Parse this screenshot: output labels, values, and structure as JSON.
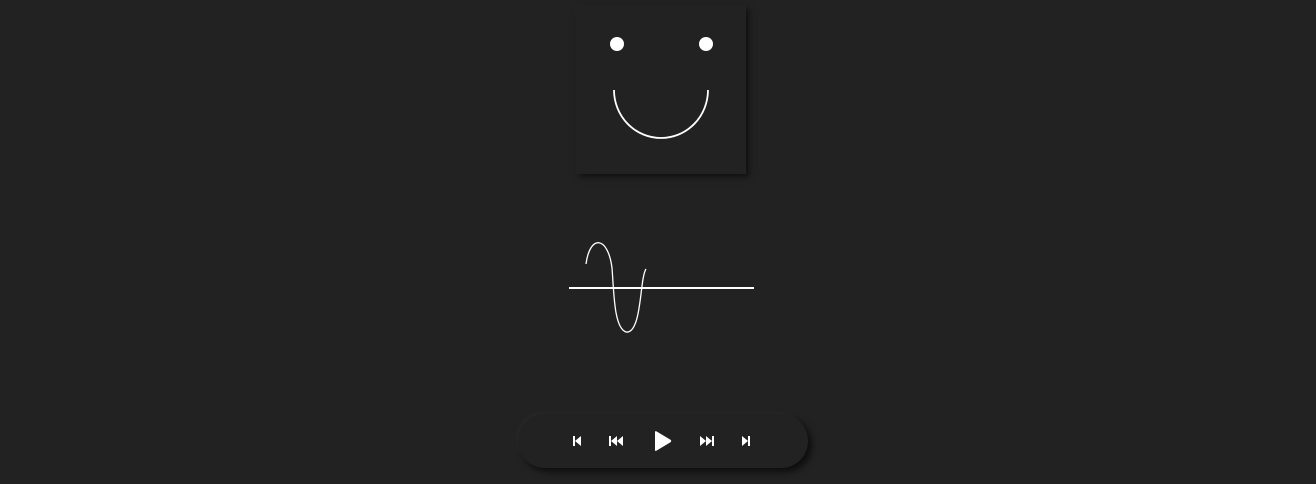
{
  "colors": {
    "background": "#222222",
    "foreground": "#ffffff"
  },
  "face": {
    "icon": "smiley-face-icon",
    "parts": [
      "left-eye",
      "right-eye",
      "smile-mouth"
    ]
  },
  "visualizer": {
    "icon": "sine-wave-icon"
  },
  "player_controls": {
    "buttons": [
      {
        "id": "skip-to-start",
        "icon": "skip-to-start-icon"
      },
      {
        "id": "rewind",
        "icon": "rewind-icon"
      },
      {
        "id": "play",
        "icon": "play-icon"
      },
      {
        "id": "fast-forward",
        "icon": "fast-forward-icon"
      },
      {
        "id": "skip-to-end",
        "icon": "skip-to-end-icon"
      }
    ]
  }
}
